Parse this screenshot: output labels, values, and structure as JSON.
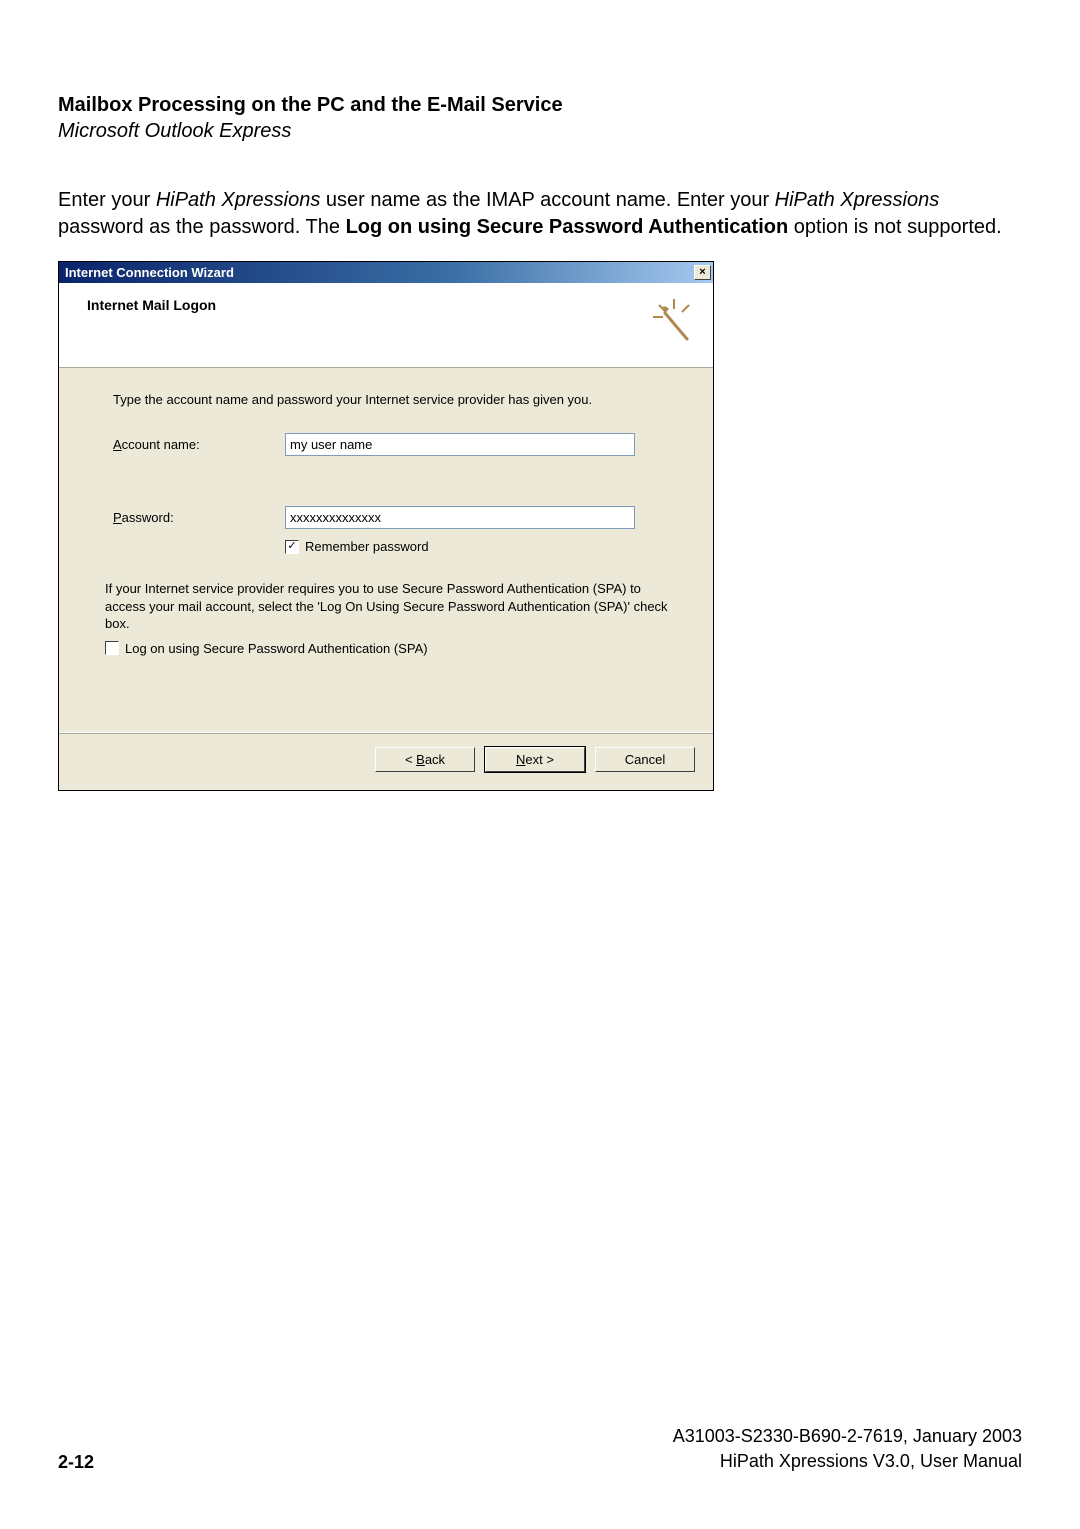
{
  "page": {
    "heading": "Mailbox Processing on the PC and the E-Mail Service",
    "subheading": "Microsoft Outlook Express",
    "para_a": "Enter your ",
    "para_b": "HiPath Xpressions",
    "para_c": " user name as the IMAP account name. Enter your ",
    "para_d": "HiPath Xpressions",
    "para_e": " password as the password. The ",
    "para_f": "Log on using Secure Password Authentication",
    "para_g": " option is not supported."
  },
  "dialog": {
    "title": "Internet Connection Wizard",
    "close": "×",
    "header": "Internet Mail Logon",
    "intro": "Type the account name and password your Internet service provider has given you.",
    "account_label_pre": "A",
    "account_label_rest": "ccount name:",
    "account_value": "my user name",
    "password_label_pre": "P",
    "password_label_rest": "assword:",
    "password_value": "xxxxxxxxxxxxxx",
    "remember_pre": "Remember pass",
    "remember_u": "w",
    "remember_post": "ord",
    "remember_checked": true,
    "spa_text": "If your Internet service provider requires you to use Secure Password Authentication (SPA) to access your mail account, select the 'Log On Using Secure Password Authentication (SPA)' check box.",
    "spa_chk_pre": "Log on using ",
    "spa_chk_u": "S",
    "spa_chk_post": "ecure Password Authentication (SPA)",
    "spa_checked": false,
    "back_pre": "< ",
    "back_u": "B",
    "back_post": "ack",
    "next_u": "N",
    "next_post": "ext >",
    "cancel": "Cancel"
  },
  "footer": {
    "page_num": "2-12",
    "line1": "A31003-S2330-B690-2-7619, January 2003",
    "line2": "HiPath Xpressions V3.0, User Manual"
  }
}
